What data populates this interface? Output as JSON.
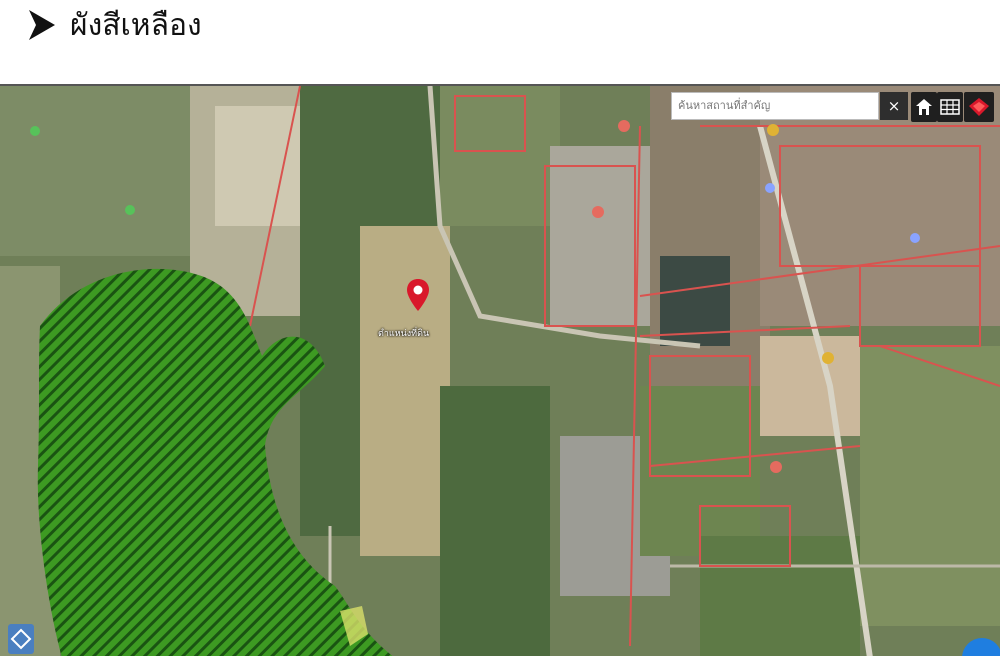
{
  "header": {
    "title": "ผังสีเหลือง"
  },
  "map": {
    "search": {
      "placeholder": "ค้นหาสถานที่สำคัญ"
    },
    "clear_label": "×",
    "pin_label": "ตำแหน่งที่ดิน",
    "tools": [
      "home-icon",
      "grid-icon",
      "layers-icon"
    ],
    "colors": {
      "zone_green": "#2e8b1e",
      "marker_red": "#d9182b",
      "fab_blue": "#1f7ee0",
      "road_red": "#d9534f"
    }
  }
}
